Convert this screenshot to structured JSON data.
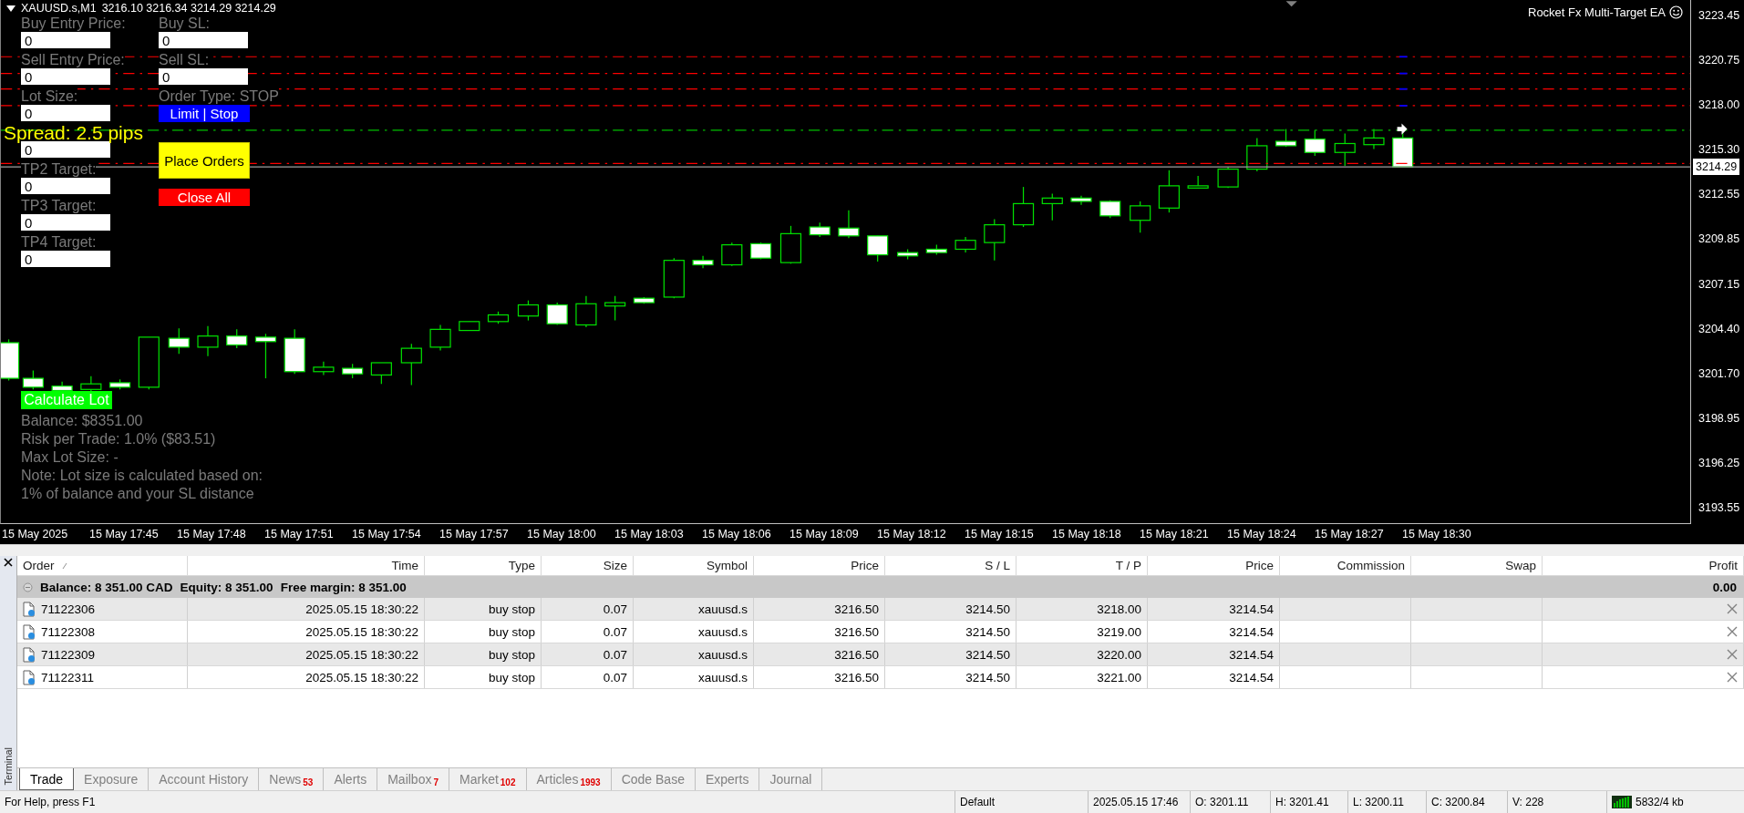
{
  "chart": {
    "symbol": "XAUUSD.s,M1",
    "quote": "3216.10 3216.34 3214.29 3214.29",
    "expert": "Rocket Fx Multi-Target EA",
    "price_axis": [
      "3223.45",
      "3220.75",
      "3218.00",
      "3215.30",
      "3212.55",
      "3209.85",
      "3207.15",
      "3204.40",
      "3201.70",
      "3198.95",
      "3196.25",
      "3193.55"
    ],
    "current_price": "3214.29",
    "time_axis": [
      "15 May 2025",
      "15 May 17:45",
      "15 May 17:48",
      "15 May 17:51",
      "15 May 17:54",
      "15 May 17:57",
      "15 May 18:00",
      "15 May 18:03",
      "15 May 18:06",
      "15 May 18:09",
      "15 May 18:12",
      "15 May 18:15",
      "15 May 18:18",
      "15 May 18:21",
      "15 May 18:24",
      "15 May 18:27",
      "15 May 18:30"
    ]
  },
  "panel": {
    "left_fields": [
      {
        "label": "Buy Entry Price:",
        "value": "0"
      },
      {
        "label": "Sell Entry Price:",
        "value": "0"
      },
      {
        "label": "Lot Size:",
        "value": "0"
      },
      {
        "value": "0"
      },
      {
        "label": "TP2 Target:",
        "value": "0"
      },
      {
        "label": "TP3 Target:",
        "value": "0"
      },
      {
        "label": "TP4 Target:",
        "value": "0"
      }
    ],
    "right_fields": [
      {
        "label": "Buy SL:",
        "value": "0"
      },
      {
        "label": "Sell SL:",
        "value": "0"
      }
    ],
    "order_type": "Order Type: STOP",
    "buttons": [
      {
        "label": "Limit | Stop",
        "color": "#0000ff",
        "kind": "short"
      },
      {
        "label": "Place Orders",
        "color": "#ffff00",
        "kind": "tall"
      },
      {
        "label": "Close All",
        "color": "#ff0000",
        "kind": "short"
      }
    ],
    "spread": "Spread: 2.5 pips",
    "calculator": {
      "button": "Calculate Lot",
      "lines": [
        "Balance: $8351.00",
        "Risk per Trade: 1.0% ($83.51)",
        "Max Lot Size: -",
        "Note: Lot size is calculated based on:",
        "1% of balance and your SL distance"
      ]
    }
  },
  "terminal": {
    "side_label": "Terminal",
    "columns": [
      {
        "label": "Order",
        "sorted": true
      },
      {
        "label": "Time",
        "sorted": false
      },
      {
        "label": "Type",
        "sorted": false
      },
      {
        "label": "Size",
        "sorted": false
      },
      {
        "label": "Symbol",
        "sorted": false
      },
      {
        "label": "Price",
        "sorted": false
      },
      {
        "label": "S / L",
        "sorted": false
      },
      {
        "label": "T / P",
        "sorted": false
      },
      {
        "label": "Price",
        "sorted": false
      },
      {
        "label": "Commission",
        "sorted": false
      },
      {
        "label": "Swap",
        "sorted": false
      },
      {
        "label": "Profit",
        "sorted": false
      }
    ],
    "summary": {
      "parts": [
        "Balance: 8 351.00 CAD",
        "Equity: 8 351.00",
        "Free margin: 8 351.00"
      ],
      "profit": "0.00"
    },
    "rows": [
      {
        "order": "71122306",
        "time": "2025.05.15 18:30:22",
        "type": "buy stop",
        "size": "0.07",
        "symbol": "xauusd.s",
        "price": "3216.50",
        "sl": "3214.50",
        "tp": "3218.00",
        "current_price": "3214.54"
      },
      {
        "order": "71122308",
        "time": "2025.05.15 18:30:22",
        "type": "buy stop",
        "size": "0.07",
        "symbol": "xauusd.s",
        "price": "3216.50",
        "sl": "3214.50",
        "tp": "3219.00",
        "current_price": "3214.54"
      },
      {
        "order": "71122309",
        "time": "2025.05.15 18:30:22",
        "type": "buy stop",
        "size": "0.07",
        "symbol": "xauusd.s",
        "price": "3216.50",
        "sl": "3214.50",
        "tp": "3220.00",
        "current_price": "3214.54"
      },
      {
        "order": "71122311",
        "time": "2025.05.15 18:30:22",
        "type": "buy stop",
        "size": "0.07",
        "symbol": "xauusd.s",
        "price": "3216.50",
        "sl": "3214.50",
        "tp": "3221.00",
        "current_price": "3214.54"
      }
    ],
    "tabs": [
      {
        "label": "Trade",
        "selected": true
      },
      {
        "label": "Exposure",
        "selected": false
      },
      {
        "label": "Account History",
        "selected": false
      },
      {
        "label": "News",
        "count": "53",
        "selected": false
      },
      {
        "label": "Alerts",
        "selected": false
      },
      {
        "label": "Mailbox",
        "count": "7",
        "selected": false
      },
      {
        "label": "Market",
        "count": "102",
        "selected": false
      },
      {
        "label": "Articles",
        "count": "1993",
        "selected": false
      },
      {
        "label": "Code Base",
        "selected": false
      },
      {
        "label": "Experts",
        "selected": false
      },
      {
        "label": "Journal",
        "selected": false
      }
    ]
  },
  "status_bar": {
    "help": "For Help, press F1",
    "fields": [
      "Default",
      "2025.05.15 17:46",
      "O: 3201.11",
      "H: 3201.41",
      "L: 3200.11",
      "C: 3200.84",
      "V: 228"
    ],
    "traffic": "5832/4 kb"
  }
}
